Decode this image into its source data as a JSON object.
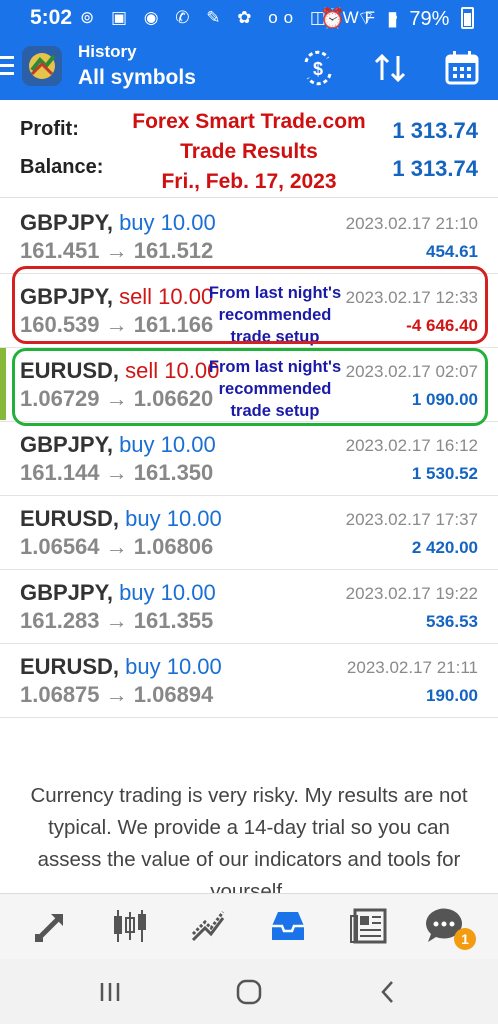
{
  "status_bar": {
    "time": "5:02",
    "left_icons": [
      "cast-icon",
      "app-icon",
      "message-icon",
      "whatsapp-icon",
      "edit-icon",
      "tag-icon",
      "voicemail-icon",
      "vibrate-icon",
      "wf-icon",
      "dot-icon"
    ],
    "left_glyphs": "⊚ ▣ ◉ ✆ ✎ ✿ oo ◫ WF •",
    "battery": "79%"
  },
  "app_bar": {
    "title_small": "History",
    "title_large": "All symbols"
  },
  "summary": {
    "profit_label": "Profit:",
    "profit_value": "1 313.74",
    "balance_label": "Balance:",
    "balance_value": "1 313.74",
    "overlay_line1": "Forex Smart Trade.com",
    "overlay_line2": "Trade Results",
    "overlay_line3": "Fri., Feb. 17, 2023"
  },
  "trades": [
    {
      "symbol": "GBPJPY,",
      "side": "buy 10.00",
      "prices": "161.451 → 161.512",
      "datetime": "2023.02.17 21:10",
      "pl": "454.61"
    },
    {
      "symbol": "GBPJPY,",
      "side": "sell 10.00",
      "prices": "160.539 → 161.166",
      "datetime": "2023.02.17 12:33",
      "pl": "-4 646.40",
      "note": "From last night's recommended trade setup"
    },
    {
      "symbol": "EURUSD,",
      "side": "sell 10.00",
      "prices": "1.06729 → 1.06620",
      "datetime": "2023.02.17 02:07",
      "pl": "1 090.00",
      "note": "From last night's recommended trade setup"
    },
    {
      "symbol": "GBPJPY,",
      "side": "buy 10.00",
      "prices": "161.144 → 161.350",
      "datetime": "2023.02.17 16:12",
      "pl": "1 530.52"
    },
    {
      "symbol": "EURUSD,",
      "side": "buy 10.00",
      "prices": "1.06564 → 1.06806",
      "datetime": "2023.02.17 17:37",
      "pl": "2 420.00"
    },
    {
      "symbol": "GBPJPY,",
      "side": "buy 10.00",
      "prices": "161.283 → 161.355",
      "datetime": "2023.02.17 19:22",
      "pl": "536.53"
    },
    {
      "symbol": "EURUSD,",
      "side": "buy 10.00",
      "prices": "1.06875 → 1.06894",
      "datetime": "2023.02.17 21:11",
      "pl": "190.00"
    }
  ],
  "disclaimer": "Currency trading is very risky. My results are not typical. We provide a 14-day trial so you can assess the value of our indicators and tools for yourself.",
  "bottom_nav": {
    "items": [
      "quotes-icon",
      "chart-icon",
      "trade-icon",
      "history-icon",
      "news-icon",
      "chat-icon"
    ],
    "chat_badge": "1"
  },
  "colors": {
    "accent": "#1a73e8",
    "buy": "#1a6fd4",
    "sell": "#d01515",
    "profit": "#1565c0",
    "box_red": "#d42020",
    "box_green": "#22b03a"
  }
}
